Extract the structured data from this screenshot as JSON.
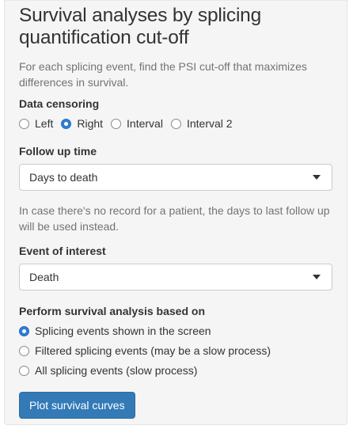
{
  "panel": {
    "title": "Survival analyses by splicing quantification cut-off",
    "description": "For each splicing event, find the PSI cut-off that maximizes differences in survival."
  },
  "censoring": {
    "label": "Data censoring",
    "options": [
      {
        "label": "Left",
        "checked": false
      },
      {
        "label": "Right",
        "checked": true
      },
      {
        "label": "Interval",
        "checked": false
      },
      {
        "label": "Interval 2",
        "checked": false
      }
    ]
  },
  "follow_up": {
    "label": "Follow up time",
    "selected": "Days to death",
    "help": "In case there's no record for a patient, the days to last follow up will be used instead."
  },
  "event": {
    "label": "Event of interest",
    "selected": "Death"
  },
  "analysis_basis": {
    "label": "Perform survival analysis based on",
    "options": [
      {
        "label": "Splicing events shown in the screen",
        "checked": true
      },
      {
        "label": "Filtered splicing events (may be a slow process)",
        "checked": false
      },
      {
        "label": "All splicing events (slow process)",
        "checked": false
      }
    ]
  },
  "actions": {
    "plot_label": "Plot survival curves"
  },
  "colors": {
    "accent": "#337ab7",
    "radio_checked": "#2f7bd6",
    "panel_bg": "#f5f5f5",
    "help_text": "#737373"
  }
}
